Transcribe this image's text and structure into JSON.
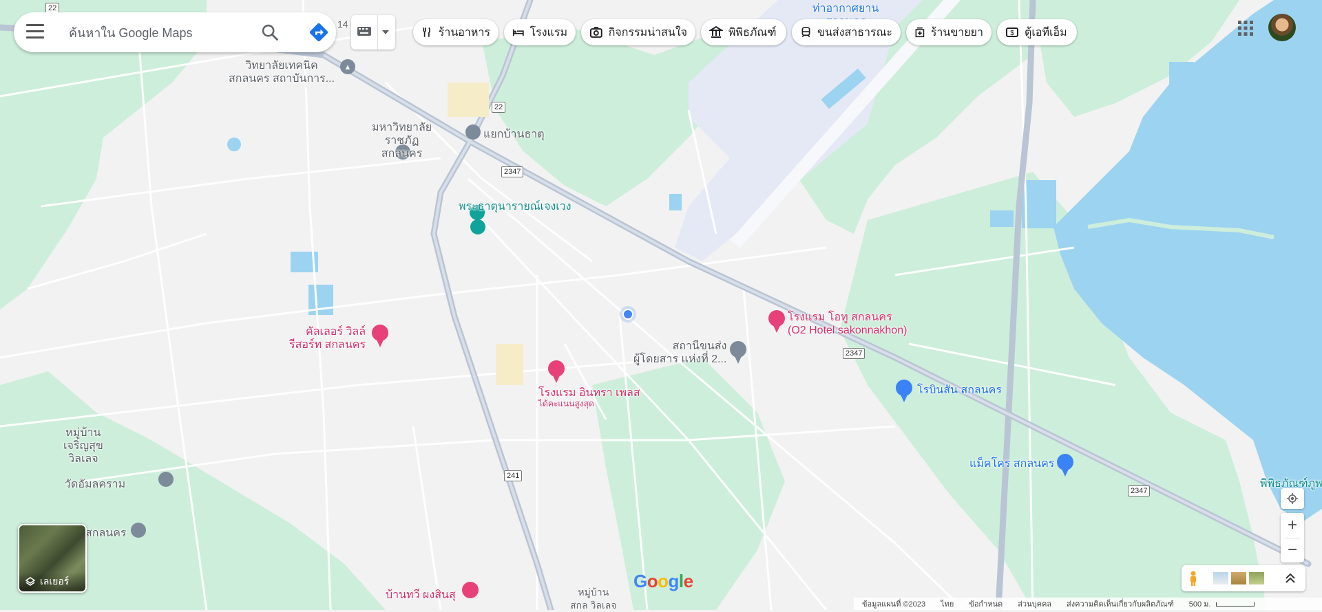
{
  "search": {
    "placeholder": "ค้นหาใน Google Maps"
  },
  "chips": [
    {
      "label": "ร้านอาหาร",
      "icon": "restaurant-icon"
    },
    {
      "label": "โรงแรม",
      "icon": "hotel-icon"
    },
    {
      "label": "กิจกรรมน่าสนใจ",
      "icon": "camera-icon"
    },
    {
      "label": "พิพิธภัณฑ์",
      "icon": "museum-icon"
    },
    {
      "label": "ขนส่งสาธารณะ",
      "icon": "transit-icon"
    },
    {
      "label": "ร้านขายยา",
      "icon": "pharmacy-icon"
    },
    {
      "label": "ตู้เอทีเอ็ม",
      "icon": "atm-icon"
    }
  ],
  "layers_label": "เลเยอร์",
  "map_labels": {
    "airport": "ท่าอากาศยาน\nสกลนคร",
    "tech_college": "วิทยาลัยเทคนิค\nสกลนคร สถาบันการ...",
    "rajabhat": "มหาวิทยาลัย\nราชภัฏ\nสกลนคร",
    "intersection": "แยกบ้านธาตุ",
    "pagoda": "พระธาตุนารายณ์เจงเวง",
    "color_villa": "คัลเลอร์ วิลล์\nรีสอร์ท สกลนคร",
    "hotel_o2": "โรงแรม โอทู สกลนคร\n(O2 Hotel sakonnakhon)",
    "bus_station": "สถานีขนส่ง\nผู้โดยสาร แห่งที่ 2...",
    "intra_place": "โรงแรม อินทรา เพลส",
    "intra_place_sub": "ได้คะแนนสูงสุด",
    "robinson": "โรบินสัน สกลนคร",
    "makro": "แม็คโคร สกลนคร",
    "village_charoen": "หมู่บ้าน\nเจริญสุข\nวิลเลจ",
    "wat_amlam": "วัดอัมลคราม",
    "sakon_left": "สกลนคร",
    "museum_right": "พิพิธภัณฑ์ภูพ",
    "ban_thawi": "บ้านทวี ผงสินสุ",
    "village_bottom": "หมู่บ้าน\nสกล วิลเลจ",
    "road_22": "22",
    "road_2347a": "2347",
    "road_2347b": "2347",
    "road_2347c": "2347",
    "road_241": "241",
    "road_22_top": "22",
    "road_14": "14"
  },
  "footer": {
    "map_data": "ข้อมูลแผนที่ ©2023",
    "language": "ไทย",
    "terms": "ข้อกำหนด",
    "privacy": "ส่วนบุคคล",
    "feedback": "ส่งความคิดเห็นเกี่ยวกับผลิตภัณฑ์",
    "scale": "500 ม."
  },
  "logo_text": "Google",
  "colors": {
    "water": "#9cd3f0",
    "park": "#c7ecd6",
    "road_major": "#b7c3d4",
    "road_minor": "#ffffff",
    "land": "#f2f2f2",
    "airport": "#e3e8f4",
    "poi_pink": "#e8417a",
    "poi_teal": "#10a39b",
    "poi_blue": "#3b82f6",
    "location_dot": "#4285f4"
  }
}
